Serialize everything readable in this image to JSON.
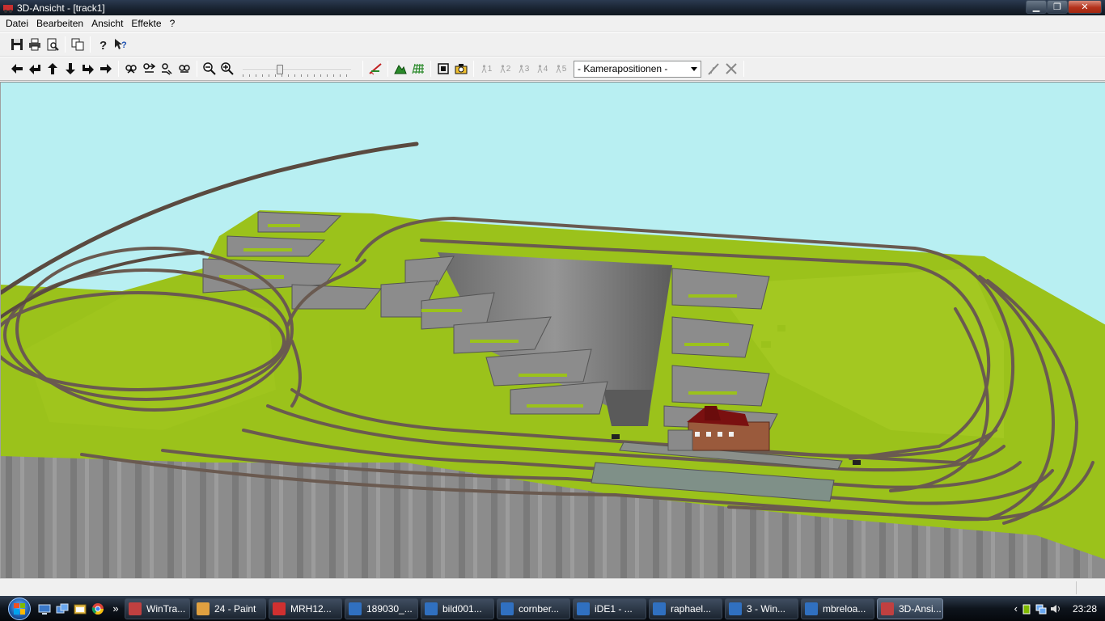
{
  "window": {
    "title": "3D-Ansicht - [track1]"
  },
  "menu": [
    "Datei",
    "Bearbeiten",
    "Ansicht",
    "Effekte",
    "?"
  ],
  "toolbar1": [
    "save-icon",
    "print-icon",
    "print-preview-icon",
    "copy-icon",
    "help-icon",
    "context-help-icon"
  ],
  "toolbar2": {
    "nav": [
      "arrow-left-icon",
      "turn-left-icon",
      "arrow-up-icon",
      "arrow-down-icon",
      "turn-right-icon",
      "arrow-right-icon"
    ],
    "view": [
      "view-tilt-up-icon",
      "view-tilt-down-icon",
      "view-rotate-left-icon",
      "view-rotate-right-icon"
    ],
    "zoom": [
      "zoom-out-icon",
      "zoom-in-icon"
    ],
    "slider_level": 0.33,
    "tools": [
      "track-edit-icon",
      "terrain-icon",
      "grid-icon",
      "fit-view-icon",
      "camera-icon"
    ],
    "cameras": [
      "1",
      "2",
      "3",
      "4",
      "5"
    ],
    "camera_select": "- Kamerapositionen -",
    "end_tools": [
      "camera-edit-icon",
      "camera-delete-icon"
    ]
  },
  "taskbar": {
    "quicklaunch": [
      "show-desktop-icon",
      "switch-windows-icon",
      "explorer-icon",
      "chrome-icon",
      "more-icon"
    ],
    "more_label": "»",
    "tasks": [
      {
        "label": "WinTra...",
        "color": "#c04040"
      },
      {
        "label": "24 - Paint",
        "color": "#e0a040"
      },
      {
        "label": "MRH12...",
        "color": "#d03030"
      },
      {
        "label": "189030_...",
        "color": "#3070c0"
      },
      {
        "label": "bild001...",
        "color": "#3070c0"
      },
      {
        "label": "cornber...",
        "color": "#3070c0"
      },
      {
        "label": "iDE1 - ...",
        "color": "#3070c0"
      },
      {
        "label": "raphael...",
        "color": "#3070c0"
      },
      {
        "label": "3 - Win...",
        "color": "#3070c0"
      },
      {
        "label": "mbreloa...",
        "color": "#3070c0"
      },
      {
        "label": "3D-Ansi...",
        "color": "#c04040",
        "active": true
      }
    ],
    "clock": "23:28"
  },
  "colors": {
    "sky": "#b8eff2",
    "grass": "#9bc21b",
    "cliff": "#7a7a7a",
    "track": "#5a4a40"
  }
}
